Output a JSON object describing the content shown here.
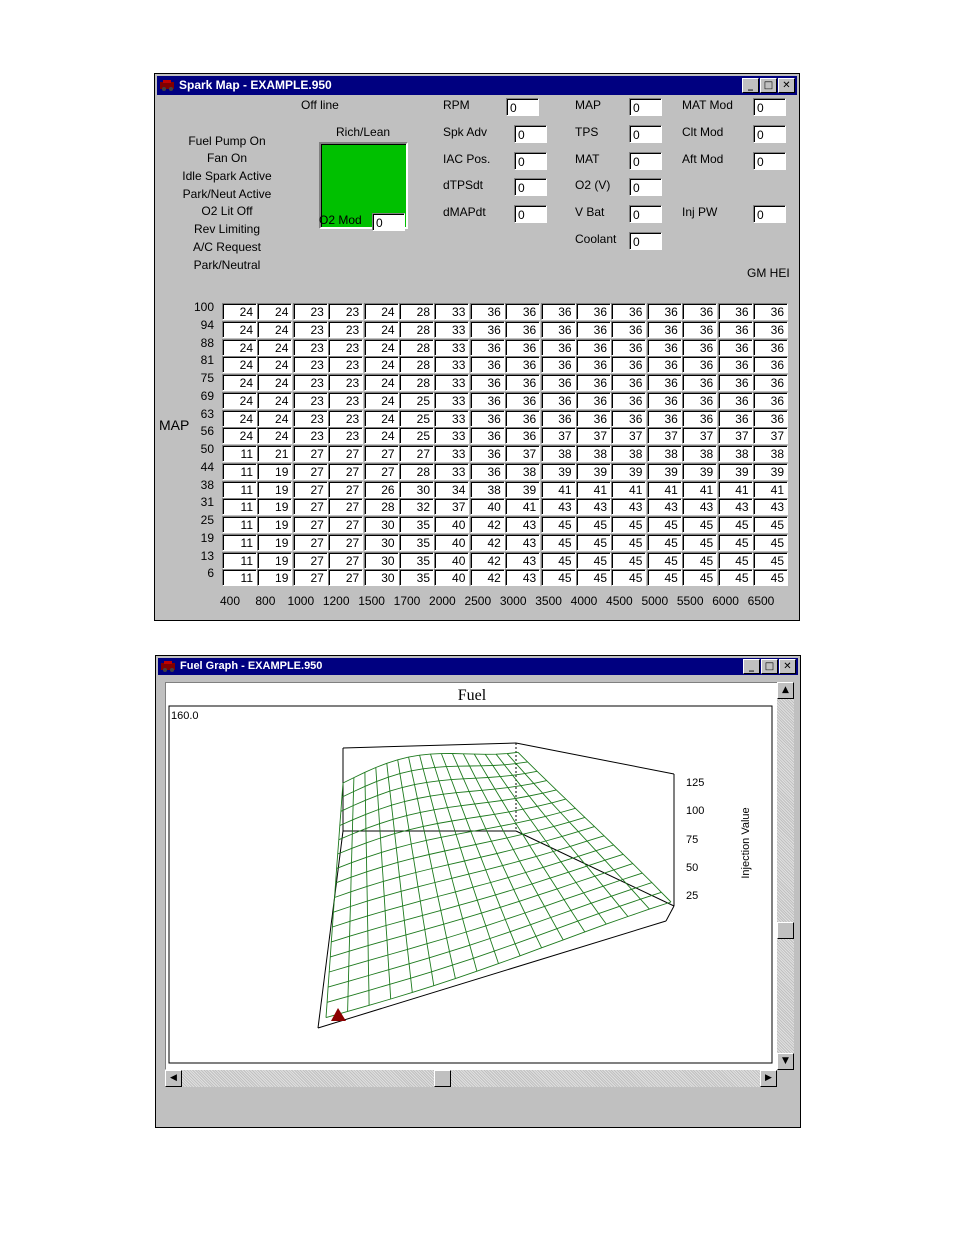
{
  "spark_window": {
    "title": "Spark Map - EXAMPLE.950",
    "offline": "Off line",
    "rich_lean": "Rich/Lean",
    "o2_mod_label": "O2 Mod",
    "o2_mod_value": "0",
    "gm_hei": "GM HEI",
    "map_axis_label": "MAP",
    "status_items": [
      "Fuel Pump On",
      "Fan On",
      "Idle Spark Active",
      "Park/Neut Active",
      "O2 Lit Off",
      "Rev Limiting",
      "A/C Request",
      "Park/Neutral"
    ],
    "fields": [
      {
        "label": "RPM",
        "value": "0"
      },
      {
        "label": "Spk Adv",
        "value": "0"
      },
      {
        "label": "IAC Pos.",
        "value": "0"
      },
      {
        "label": "dTPSdt",
        "value": "0"
      },
      {
        "label": "dMAPdt",
        "value": "0"
      },
      {
        "label": "MAP",
        "value": "0"
      },
      {
        "label": "TPS",
        "value": "0"
      },
      {
        "label": "MAT",
        "value": "0"
      },
      {
        "label": "O2 (V)",
        "value": "0"
      },
      {
        "label": "V Bat",
        "value": "0"
      },
      {
        "label": "Coolant",
        "value": "0"
      },
      {
        "label": "MAT Mod",
        "value": "0"
      },
      {
        "label": "Clt Mod",
        "value": "0"
      },
      {
        "label": "Aft Mod",
        "value": "0"
      },
      {
        "label": "Inj PW",
        "value": "0"
      }
    ],
    "rpm_columns": [
      "400",
      "800",
      "1000",
      "1200",
      "1500",
      "1700",
      "2000",
      "2500",
      "3000",
      "3500",
      "4000",
      "4500",
      "5000",
      "5500",
      "6000",
      "6500"
    ],
    "map_rows": [
      "100",
      "94",
      "88",
      "81",
      "75",
      "69",
      "63",
      "56",
      "50",
      "44",
      "38",
      "31",
      "25",
      "19",
      "13",
      "6"
    ],
    "table": [
      [
        24,
        24,
        23,
        23,
        24,
        28,
        33,
        36,
        36,
        36,
        36,
        36,
        36,
        36,
        36,
        36
      ],
      [
        24,
        24,
        23,
        23,
        24,
        28,
        33,
        36,
        36,
        36,
        36,
        36,
        36,
        36,
        36,
        36
      ],
      [
        24,
        24,
        23,
        23,
        24,
        28,
        33,
        36,
        36,
        36,
        36,
        36,
        36,
        36,
        36,
        36
      ],
      [
        24,
        24,
        23,
        23,
        24,
        28,
        33,
        36,
        36,
        36,
        36,
        36,
        36,
        36,
        36,
        36
      ],
      [
        24,
        24,
        23,
        23,
        24,
        28,
        33,
        36,
        36,
        36,
        36,
        36,
        36,
        36,
        36,
        36
      ],
      [
        24,
        24,
        23,
        23,
        24,
        25,
        33,
        36,
        36,
        36,
        36,
        36,
        36,
        36,
        36,
        36
      ],
      [
        24,
        24,
        23,
        23,
        24,
        25,
        33,
        36,
        36,
        36,
        36,
        36,
        36,
        36,
        36,
        36
      ],
      [
        24,
        24,
        23,
        23,
        24,
        25,
        33,
        36,
        36,
        37,
        37,
        37,
        37,
        37,
        37,
        37
      ],
      [
        11,
        21,
        27,
        27,
        27,
        27,
        33,
        36,
        37,
        38,
        38,
        38,
        38,
        38,
        38,
        38
      ],
      [
        11,
        19,
        27,
        27,
        27,
        28,
        33,
        36,
        38,
        39,
        39,
        39,
        39,
        39,
        39,
        39
      ],
      [
        11,
        19,
        27,
        27,
        26,
        30,
        34,
        38,
        39,
        41,
        41,
        41,
        41,
        41,
        41,
        41
      ],
      [
        11,
        19,
        27,
        27,
        28,
        32,
        37,
        40,
        41,
        43,
        43,
        43,
        43,
        43,
        43,
        43
      ],
      [
        11,
        19,
        27,
        27,
        30,
        35,
        40,
        42,
        43,
        45,
        45,
        45,
        45,
        45,
        45,
        45
      ],
      [
        11,
        19,
        27,
        27,
        30,
        35,
        40,
        42,
        43,
        45,
        45,
        45,
        45,
        45,
        45,
        45
      ],
      [
        11,
        19,
        27,
        27,
        30,
        35,
        40,
        42,
        43,
        45,
        45,
        45,
        45,
        45,
        45,
        45
      ],
      [
        11,
        19,
        27,
        27,
        30,
        35,
        40,
        42,
        43,
        45,
        45,
        45,
        45,
        45,
        45,
        45
      ]
    ]
  },
  "fuel_window": {
    "title": "Fuel Graph - EXAMPLE.950",
    "chart_title": "Fuel",
    "corner_value": "160.0",
    "z_axis_label": "Injection Value",
    "z_ticks": [
      "125",
      "100",
      "75",
      "50",
      "25"
    ],
    "grid_color": "#1e7a1e",
    "marker_color": "#8b0000"
  },
  "colors": {
    "titlebar": "#000080",
    "window": "#c0c0c0",
    "rich_lean": "#00c000"
  }
}
